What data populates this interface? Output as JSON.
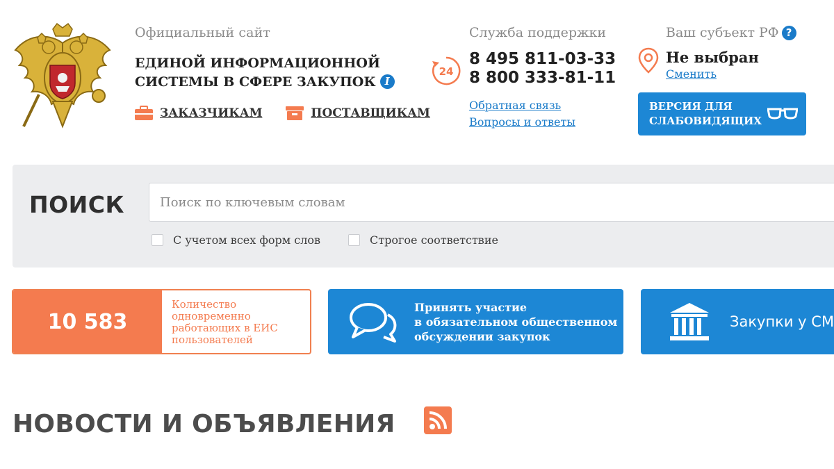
{
  "header": {
    "site_subtitle": "Официальный сайт",
    "site_title_line1": "Единой информационной",
    "site_title_line2": "системы в сфере закупок",
    "info_icon_glyph": "i",
    "role_links": [
      {
        "label": "ЗАКАЗЧИКАМ",
        "icon": "briefcase-icon"
      },
      {
        "label": "ПОСТАВЩИКАМ",
        "icon": "box-icon"
      }
    ]
  },
  "support": {
    "title": "Служба поддержки",
    "badge": "24",
    "phone1": "8 495 811-03-33",
    "phone2": "8 800 333-81-11",
    "feedback_link": "Обратная связь",
    "faq_link": "Вопросы и ответы"
  },
  "region": {
    "title": "Ваш субъект РФ",
    "help_glyph": "?",
    "value": "Не выбран",
    "change_link": "Сменить"
  },
  "accessibility_button": {
    "line1": "Версия для",
    "line2": "слабовидящих"
  },
  "search": {
    "title": "ПОИСК",
    "placeholder": "Поиск по ключевым словам",
    "option1": "С учетом всех форм слов",
    "option2": "Строгое соответствие"
  },
  "tiles": {
    "users_count": "10 583",
    "users_text": "Количество одновременно работающих в ЕИС пользователей",
    "discussion_line1": "Принять участие",
    "discussion_line2": "в обязательном общественном",
    "discussion_line3": "обсуждении закупок",
    "smp_label": "Закупки у СМ"
  },
  "news": {
    "title": "НОВОСТИ И ОБЪЯВЛЕНИЯ",
    "rss_icon": "rss-icon"
  },
  "colors": {
    "accent_blue": "#1d87d5",
    "accent_orange": "#f47b4f",
    "panel_gray": "#ecedef"
  }
}
